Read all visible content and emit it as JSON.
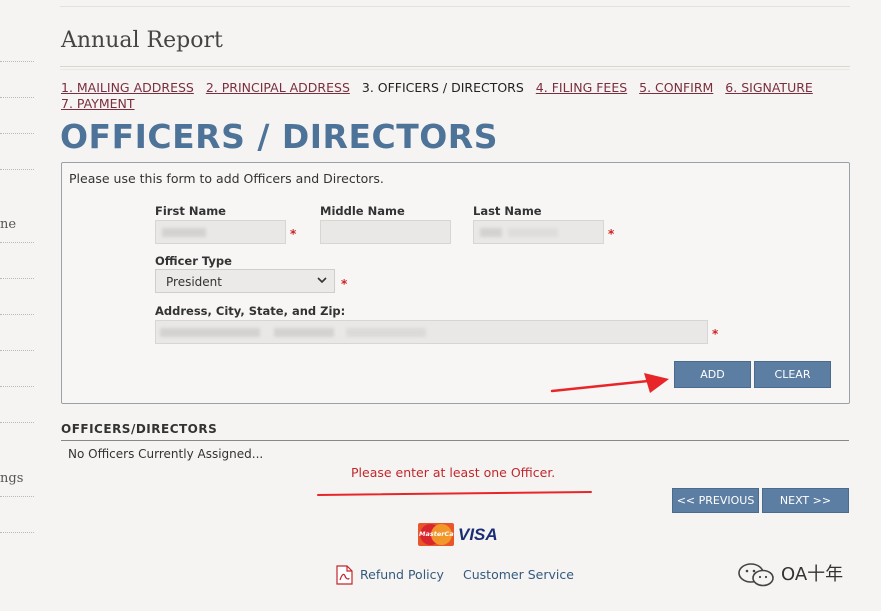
{
  "sidebar": {
    "fragments": [
      "ne",
      "ngs"
    ]
  },
  "page": {
    "heading": "Annual Report",
    "section_title": "OFFICERS / DIRECTORS"
  },
  "steps": [
    {
      "label": "1. MAILING ADDRESS",
      "current": false
    },
    {
      "label": "2. PRINCIPAL ADDRESS",
      "current": false
    },
    {
      "label": "3. OFFICERS / DIRECTORS",
      "current": true
    },
    {
      "label": "4. FILING FEES",
      "current": false
    },
    {
      "label": "5. CONFIRM",
      "current": false
    },
    {
      "label": "6. SIGNATURE",
      "current": false
    },
    {
      "label": "7. PAYMENT",
      "current": false
    }
  ],
  "form": {
    "intro": "Please use this form to add Officers and Directors.",
    "first_name_label": "First Name",
    "middle_name_label": "Middle Name",
    "last_name_label": "Last Name",
    "officer_type_label": "Officer Type",
    "officer_type_value": "President",
    "address_label": "Address, City, State, and Zip:",
    "required_marker": "*",
    "add_button": "ADD",
    "clear_button": "CLEAR"
  },
  "officers": {
    "heading": "OFFICERS/DIRECTORS",
    "empty_message": "No Officers Currently Assigned...",
    "error_message": "Please enter at least one Officer."
  },
  "navigation": {
    "previous_button": "<< PREVIOUS",
    "next_button": "NEXT >>"
  },
  "payment": {
    "mastercard_label": "MasterCard",
    "visa_label": "VISA"
  },
  "footer": {
    "refund_policy": "Refund Policy",
    "customer_service": "Customer Service"
  },
  "watermark": {
    "text": "OA十年"
  },
  "colors": {
    "accent": "#4e7399",
    "button": "#5d7ea3",
    "error": "#c0272d",
    "annotation_arrow": "#e8262a"
  }
}
